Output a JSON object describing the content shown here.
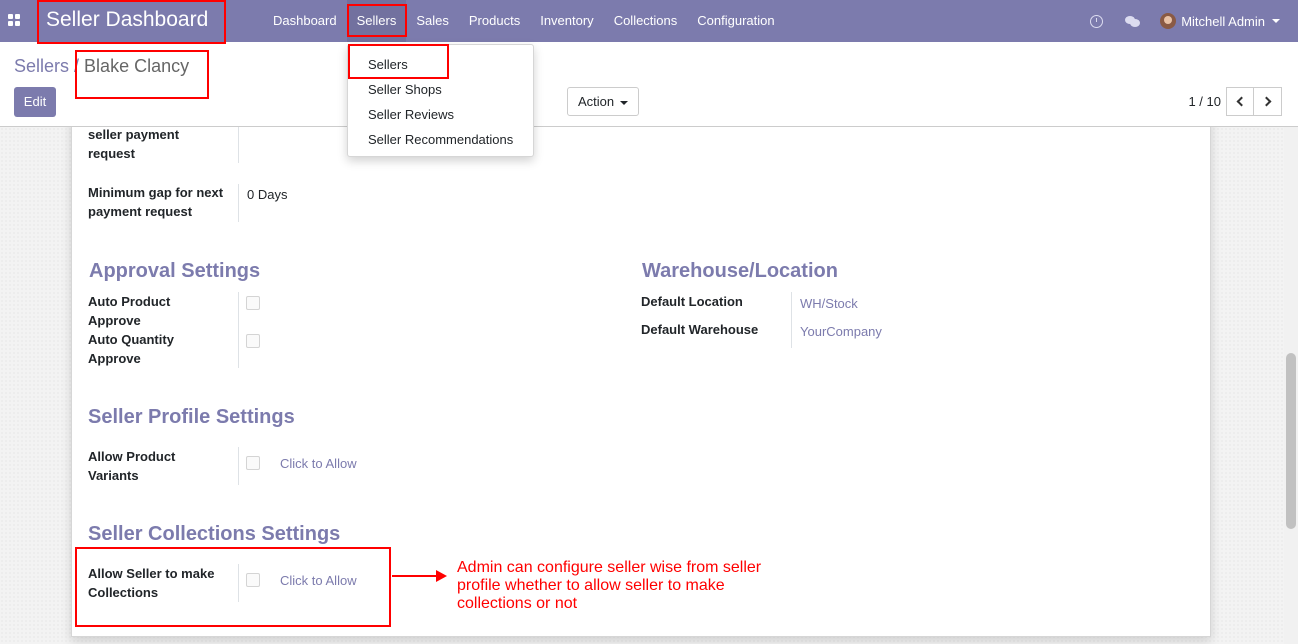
{
  "navbar": {
    "app_title": "Seller Dashboard",
    "menu": [
      "Dashboard",
      "Sellers",
      "Sales",
      "Products",
      "Inventory",
      "Collections",
      "Configuration"
    ],
    "active_menu": "Sellers",
    "user_name": "Mitchell Admin"
  },
  "sellers_dropdown": [
    "Sellers",
    "Seller Shops",
    "Seller Reviews",
    "Seller Recommendations"
  ],
  "control_panel": {
    "breadcrumb_parent": "Sellers",
    "breadcrumb_separator": "/",
    "breadcrumb_current": "Blake Clancy",
    "edit_label": "Edit",
    "action_label": "Action",
    "pager_value": "1 / 10"
  },
  "form": {
    "payment_request_label": "seller payment request",
    "min_gap_label": "Minimum gap for next payment request",
    "min_gap_value": "0 Days",
    "approval_title": "Approval Settings",
    "auto_product_approve_label": "Auto Product Approve",
    "auto_quantity_approve_label": "Auto Quantity Approve",
    "warehouse_title": "Warehouse/Location",
    "default_location_label": "Default Location",
    "default_location_value": "WH/Stock",
    "default_warehouse_label": "Default Warehouse",
    "default_warehouse_value": "YourCompany",
    "profile_title": "Seller Profile Settings",
    "allow_variants_label": "Allow Product Variants",
    "allow_variants_hint": "Click to Allow",
    "collections_title": "Seller Collections Settings",
    "allow_collections_label": "Allow Seller to make Collections",
    "allow_collections_hint": "Click to Allow"
  },
  "annotation": {
    "note": "Admin can configure seller wise from seller profile whether to allow seller to make collections or not",
    "color": "#ff0000"
  },
  "colors": {
    "brand": "#7c7bad",
    "annotation": "#ff0000"
  }
}
